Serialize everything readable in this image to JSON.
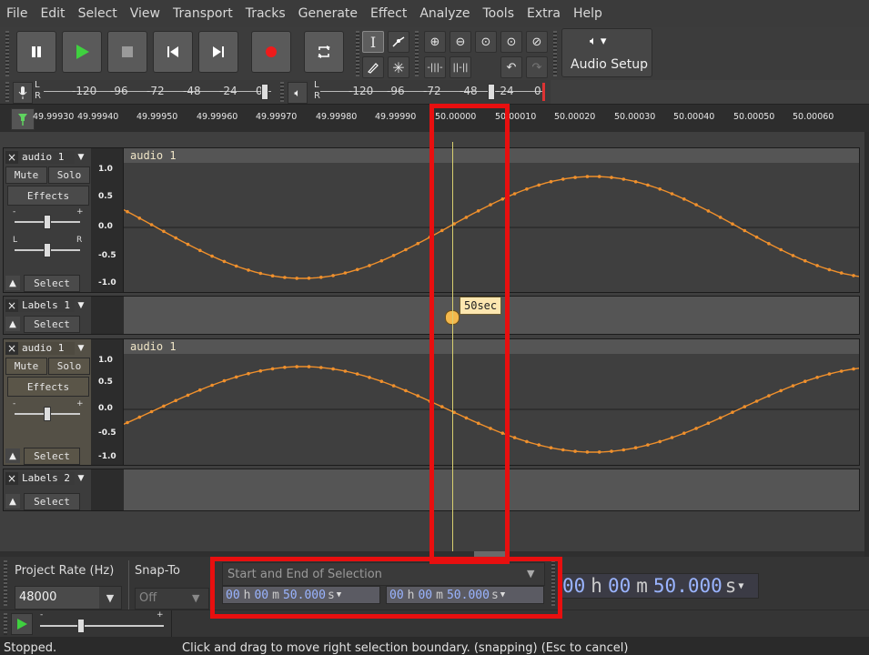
{
  "menu": [
    "File",
    "Edit",
    "Select",
    "View",
    "Transport",
    "Tracks",
    "Generate",
    "Effect",
    "Analyze",
    "Tools",
    "Extra",
    "Help"
  ],
  "audio_setup": {
    "label": "Audio Setup"
  },
  "meters": {
    "record_scale": [
      "-120",
      "-96",
      "-72",
      "-48",
      "-24",
      "0"
    ],
    "play_scale": [
      "-120",
      "-96",
      "-72",
      "-48",
      "-24",
      "0"
    ],
    "channel_l": "L",
    "channel_r": "R"
  },
  "timeline": {
    "ticks": [
      "49.99930",
      "49.99940",
      "49.99950",
      "49.99960",
      "49.99970",
      "49.99980",
      "49.99990",
      "50.00000",
      "50.00010",
      "50.00020",
      "50.00030",
      "50.00040",
      "50.00050",
      "50.00060"
    ]
  },
  "tracks": {
    "audio1": {
      "name": "audio 1",
      "clip": "audio 1",
      "mute": "Mute",
      "solo": "Solo",
      "effects": "Effects",
      "select": "Select",
      "gain_minus": "-",
      "gain_plus": "+",
      "pan_l": "L",
      "pan_r": "R"
    },
    "labels1": {
      "name": "Labels 1",
      "select": "Select",
      "label_text": "50sec"
    },
    "audio2": {
      "name": "audio 1",
      "clip": "audio 1",
      "mute": "Mute",
      "solo": "Solo",
      "effects": "Effects",
      "select": "Select",
      "gain_minus": "-",
      "gain_plus": "+"
    },
    "labels2": {
      "name": "Labels 2",
      "select": "Select"
    },
    "vscale": [
      "1.0",
      "0.5",
      "0.0",
      "-0.5",
      "-1.0"
    ]
  },
  "bottom": {
    "project_rate_label": "Project Rate (Hz)",
    "project_rate_value": "48000",
    "snap_to_label": "Snap-To",
    "snap_to_value": "Off",
    "selection_mode": "Start and End of Selection",
    "selection_start": {
      "h": "00",
      "m": "00",
      "s": "50.000"
    },
    "selection_end": {
      "h": "00",
      "m": "00",
      "s": "50.000"
    },
    "audio_position": {
      "h": "00",
      "m": "00",
      "s": "50.000"
    },
    "unit_h": "h",
    "unit_m": "m",
    "unit_s": "s",
    "speed_minus": "-",
    "speed_plus": "+"
  },
  "status": {
    "state": "Stopped.",
    "message": "Click and drag to move right selection boundary. (snapping) (Esc to cancel)"
  },
  "colors": {
    "waveform": "#f0902c",
    "highlight": "#e80f0f",
    "cursor": "#e8e070"
  }
}
